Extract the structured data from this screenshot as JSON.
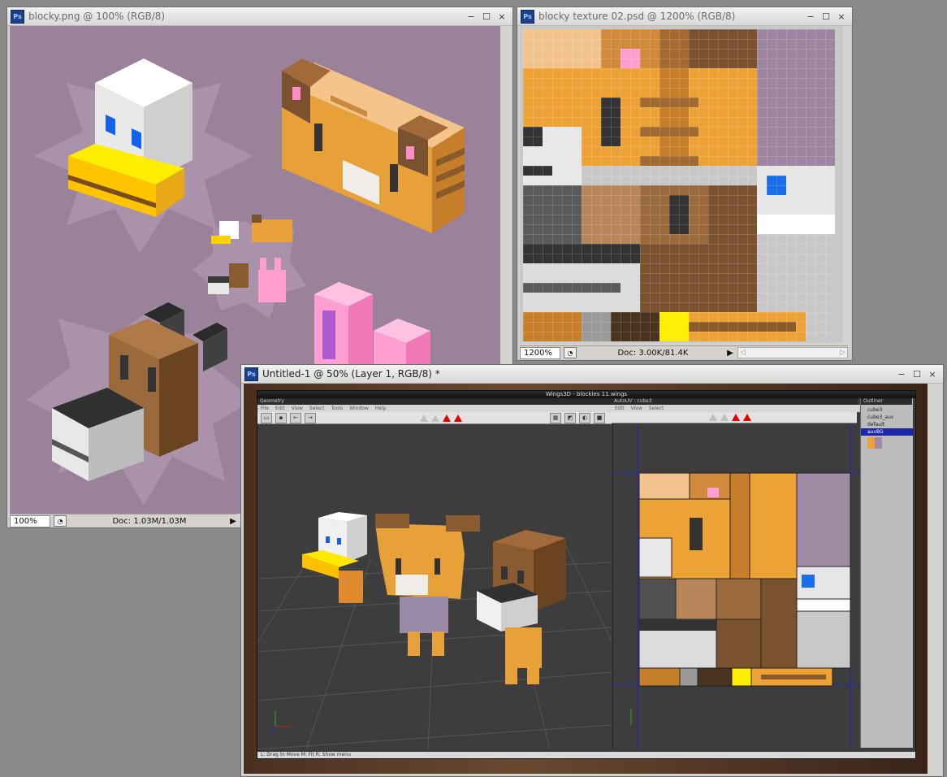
{
  "win_blocky": {
    "title": "blocky.png @ 100% (RGB/8)",
    "zoom": "100%",
    "doc": "Doc: 1.03M/1.03M"
  },
  "win_texture": {
    "title": "blocky texture 02.psd @ 1200% (RGB/8)",
    "zoom": "1200%",
    "doc": "Doc: 3.00K/81.4K"
  },
  "win_untitled": {
    "title": "Untitled-1 @ 50% (Layer 1, RGB/8) *"
  },
  "window_buttons": {
    "minimize": "−",
    "maximize": "☐",
    "close": "×"
  },
  "ps_icon": "Ps",
  "wings": {
    "title": "Wings3D - blockies 11.wings",
    "geometry_tab": "Geometry",
    "autouv_tab": "AutoUV : cube3",
    "outliner_tab": "Outliner",
    "geometry_menu": [
      "File",
      "Edit",
      "View",
      "Select",
      "Tools",
      "Window",
      "Help"
    ],
    "autouv_menu": [
      "Edit",
      "View",
      "Select"
    ],
    "outliner_items": [
      "cube3",
      "cube3_auv",
      "default",
      "auvBG"
    ],
    "status": "L: Drag to Move   M: Fit   R: Show menu"
  },
  "colors": {
    "purple_bg": "#9a829a",
    "uv_purple": "#a08aa4",
    "orange": "#e8a038",
    "brown": "#7a5230",
    "dark": "#404040",
    "viewport": "#3b3b3b",
    "highlight": "#1c27a8"
  }
}
